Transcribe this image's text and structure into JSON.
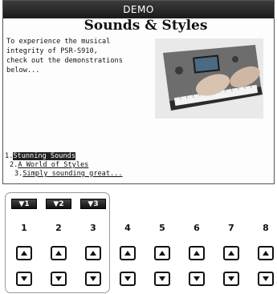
{
  "window": {
    "title": "DEMO"
  },
  "main": {
    "heading": "Sounds & Styles",
    "intro": "To experience the musical\nintegrity of PSR-S910,\ncheck out the demonstrations\nbelow...",
    "menu": [
      {
        "num": "1.",
        "label": "Stunning Sounds"
      },
      {
        "num": "2.",
        "label": "A World of Styles"
      },
      {
        "num": "3.",
        "label": "Simply sounding great..."
      }
    ]
  },
  "tabs": [
    {
      "label": "▼1"
    },
    {
      "label": "▼2"
    },
    {
      "label": "▼3"
    }
  ],
  "columns": [
    "1",
    "2",
    "3",
    "4",
    "5",
    "6",
    "7",
    "8"
  ],
  "icons": {
    "up": "up-arrow-icon",
    "down": "down-arrow-icon"
  },
  "colors": {
    "titlebar": "#2a2a2a",
    "selected": "#222222"
  }
}
